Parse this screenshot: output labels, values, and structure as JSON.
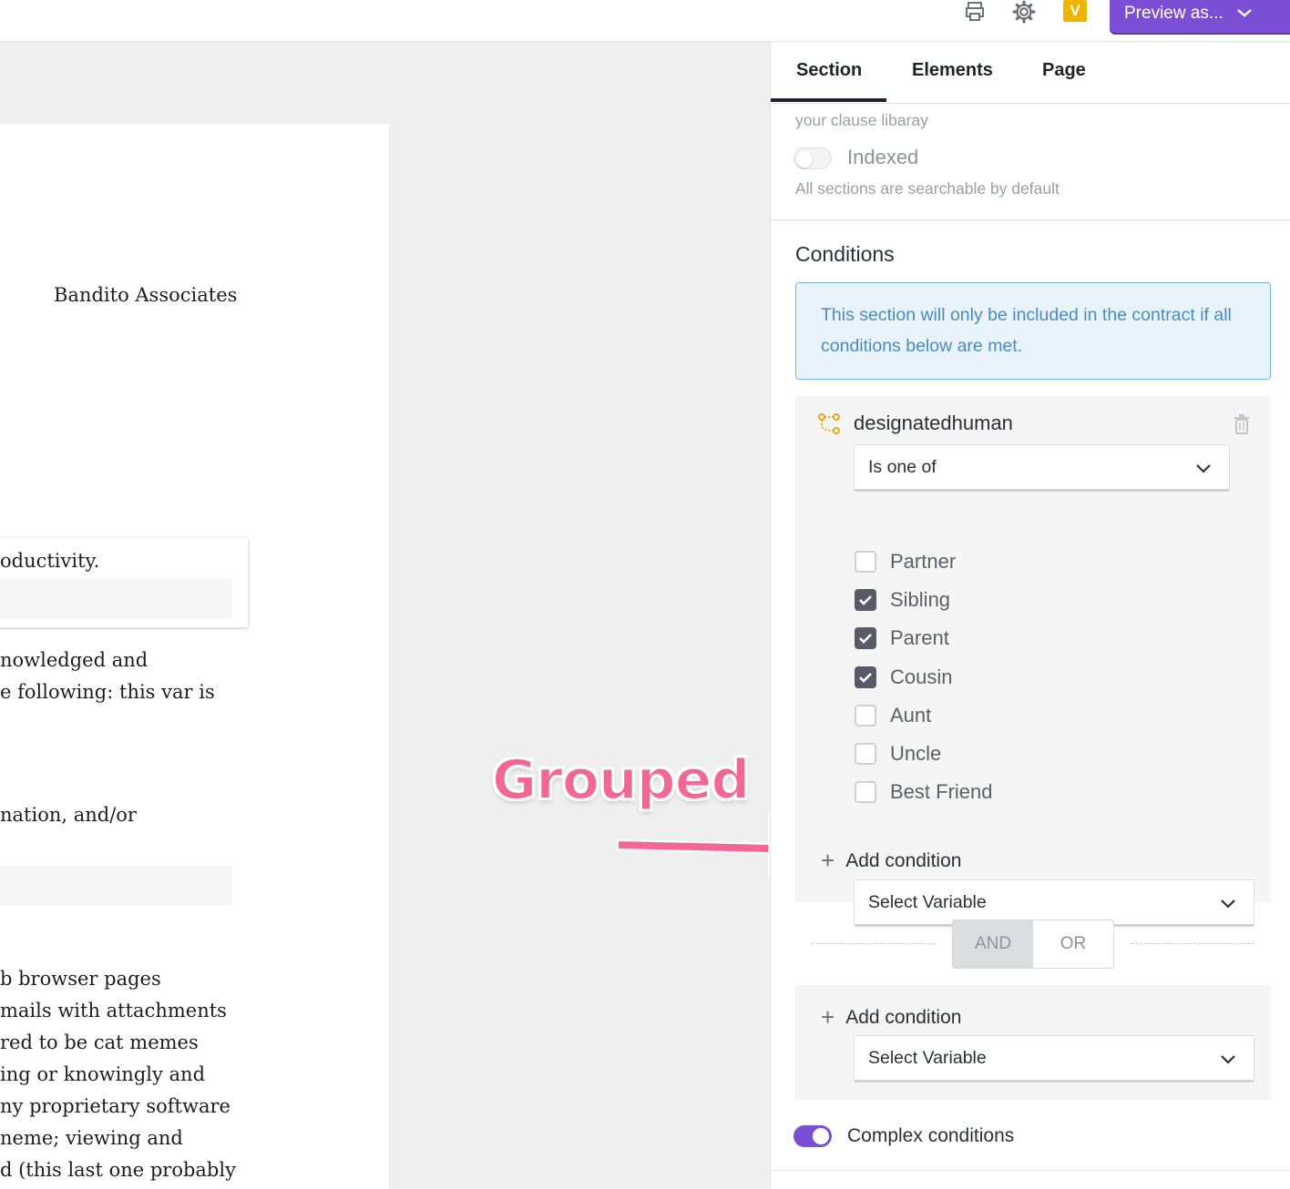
{
  "topbar": {
    "icons": [
      "print-icon",
      "gear-icon",
      "brand-v-icon"
    ],
    "brand_letter": "V",
    "preview_label": "Preview as..."
  },
  "document": {
    "company": "Bandito Associates",
    "card_text": "oductivity.",
    "para1": [
      "nowledged and",
      "e following: this var is"
    ],
    "para2": "nation, and/or",
    "list_lines": [
      "b browser pages",
      "mails with attachments",
      "red to be cat memes",
      "ing or knowingly and",
      "ny proprietary software",
      "neme; viewing and",
      "d (this last one probably"
    ]
  },
  "annotation": {
    "text": "Grouped",
    "color": "#f26795"
  },
  "panel": {
    "tabs": [
      "Section",
      "Elements",
      "Page"
    ],
    "active_tab": "Section",
    "clause_note": "your clause libaray",
    "indexed_label": "Indexed",
    "indexed_on": false,
    "indexed_help": "All sections are searchable by default",
    "conditions_title": "Conditions",
    "info_text": "This section will only be included in the contract if all conditions below are met.",
    "condition1": {
      "variable": "designatedhuman",
      "operator": "Is one of",
      "options": [
        {
          "label": "Partner",
          "checked": false
        },
        {
          "label": "Sibling",
          "checked": true
        },
        {
          "label": "Parent",
          "checked": true
        },
        {
          "label": "Cousin",
          "checked": true
        },
        {
          "label": "Aunt",
          "checked": false
        },
        {
          "label": "Uncle",
          "checked": false
        },
        {
          "label": "Best Friend",
          "checked": false
        }
      ],
      "add_condition": "Add condition",
      "select_placeholder": "Select Variable"
    },
    "logic": {
      "and": "AND",
      "or": "OR",
      "selected": "AND"
    },
    "condition2": {
      "add_condition": "Add condition",
      "select_placeholder": "Select Variable"
    },
    "complex_label": "Complex conditions",
    "complex_on": true,
    "colors": {
      "accent": "#7b4fd4",
      "info_bg": "#e8f3fc",
      "info_text": "#4c8bc0",
      "variable_icon": "#f0a21a"
    }
  }
}
